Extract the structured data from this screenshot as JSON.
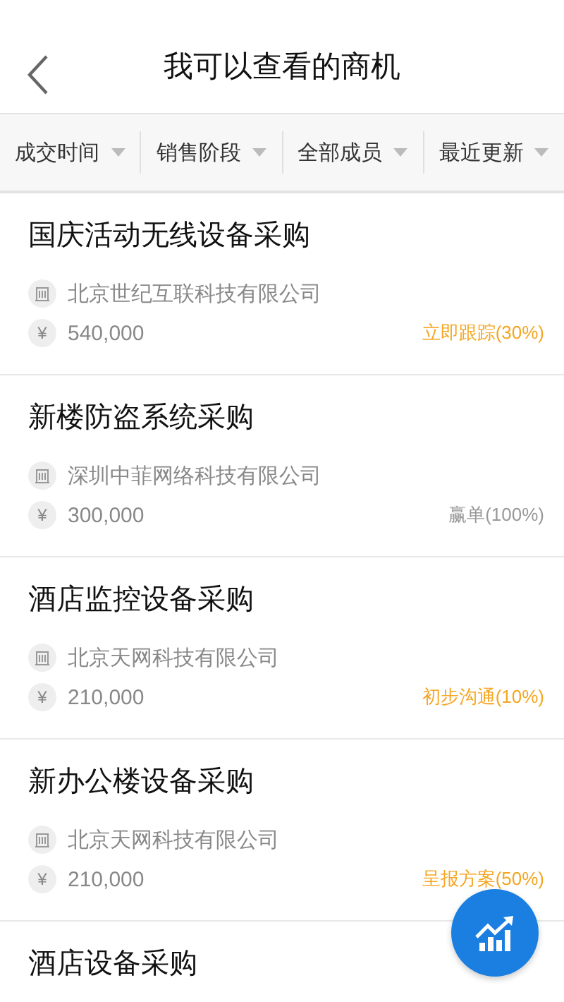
{
  "header": {
    "title": "我可以查看的商机"
  },
  "filters": [
    {
      "label": "成交时间"
    },
    {
      "label": "销售阶段"
    },
    {
      "label": "全部成员"
    },
    {
      "label": "最近更新"
    }
  ],
  "opportunities": [
    {
      "title": "国庆活动无线设备采购",
      "company": "北京世纪互联科技有限公司",
      "amount": "540,000",
      "stage": "立即跟踪(30%)",
      "color": "#f5a623"
    },
    {
      "title": "新楼防盗系统采购",
      "company": "深圳中菲网络科技有限公司",
      "amount": "300,000",
      "stage": "赢单(100%)",
      "color": "#999999"
    },
    {
      "title": "酒店监控设备采购",
      "company": "北京天网科技有限公司",
      "amount": "210,000",
      "stage": "初步沟通(10%)",
      "color": "#f5a623"
    },
    {
      "title": "新办公楼设备采购",
      "company": "北京天网科技有限公司",
      "amount": "210,000",
      "stage": "呈报方案(50%)",
      "color": "#f5a623"
    },
    {
      "title": "酒店设备采购"
    }
  ],
  "currency_symbol": "¥"
}
